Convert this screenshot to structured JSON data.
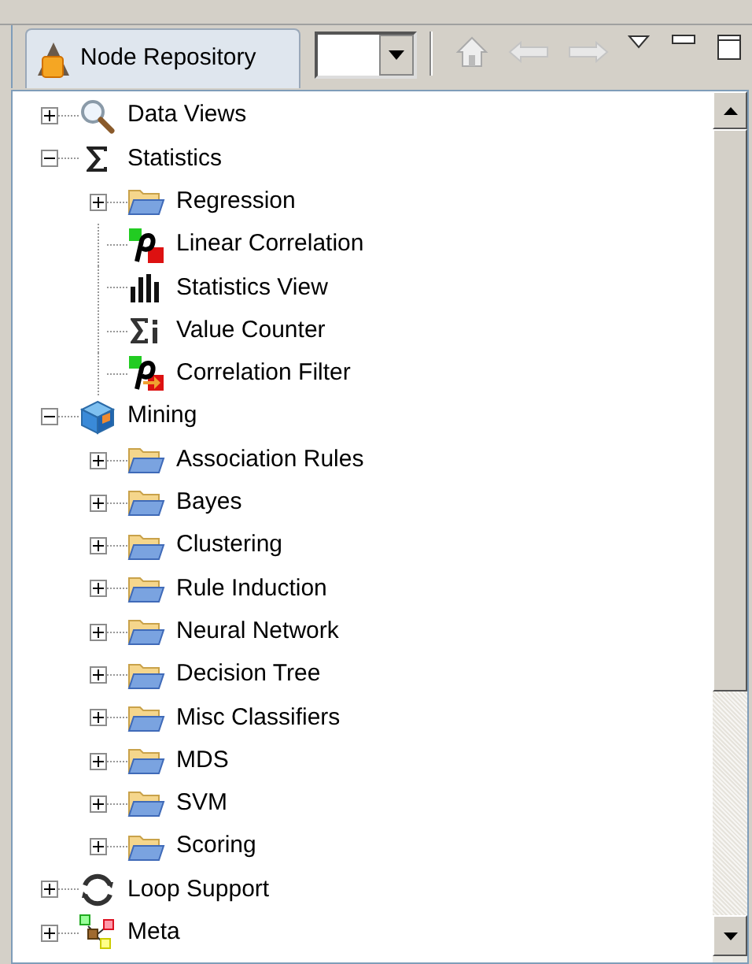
{
  "tab": {
    "label": "Node Repository",
    "selected": true
  },
  "tree": [
    {
      "label": "Data Views",
      "kind": "search",
      "expanded": false
    },
    {
      "label": "Statistics",
      "kind": "sigma",
      "expanded": true,
      "children": [
        {
          "label": "Regression",
          "kind": "folder",
          "expanded": false
        },
        {
          "label": "Linear Correlation",
          "kind": "correlation"
        },
        {
          "label": "Statistics View",
          "kind": "bars"
        },
        {
          "label": "Value Counter",
          "kind": "counter"
        },
        {
          "label": "Correlation Filter",
          "kind": "filter"
        }
      ]
    },
    {
      "label": "Mining",
      "kind": "cube",
      "expanded": true,
      "children": [
        {
          "label": "Association Rules",
          "kind": "folder",
          "expanded": false
        },
        {
          "label": "Bayes",
          "kind": "folder",
          "expanded": false
        },
        {
          "label": "Clustering",
          "kind": "folder",
          "expanded": false
        },
        {
          "label": "Rule Induction",
          "kind": "folder",
          "expanded": false
        },
        {
          "label": "Neural Network",
          "kind": "folder",
          "expanded": false
        },
        {
          "label": "Decision Tree",
          "kind": "folder",
          "expanded": false
        },
        {
          "label": "Misc Classifiers",
          "kind": "folder",
          "expanded": false
        },
        {
          "label": "MDS",
          "kind": "folder",
          "expanded": false
        },
        {
          "label": "SVM",
          "kind": "folder",
          "expanded": false
        },
        {
          "label": "Scoring",
          "kind": "folder",
          "expanded": false
        }
      ]
    },
    {
      "label": "Loop Support",
      "kind": "loop",
      "expanded": false
    },
    {
      "label": "Meta",
      "kind": "meta",
      "expanded": false
    }
  ]
}
